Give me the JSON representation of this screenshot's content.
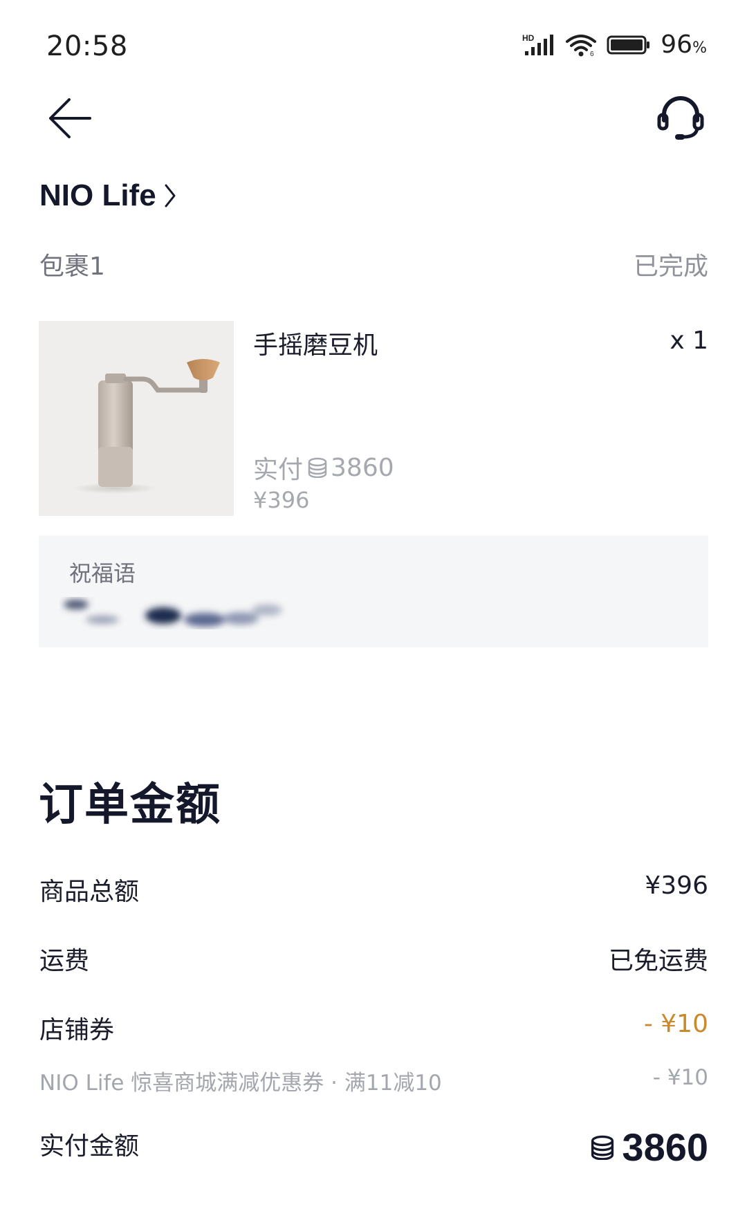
{
  "status_bar": {
    "time": "20:58",
    "battery_percent": "96",
    "battery_unit": "%",
    "signal_badge": "HD"
  },
  "header": {
    "back_icon": "back-arrow-icon",
    "support_icon": "headset-icon"
  },
  "store": {
    "name": "NIO Life",
    "chevron_icon": "chevron-right-icon"
  },
  "package": {
    "label": "包裹1",
    "status": "已完成"
  },
  "product": {
    "name": "手摇磨豆机",
    "quantity": "x 1",
    "paid_prefix": "实付",
    "paid_points": "3860",
    "price": "¥396",
    "image_icon": "coffee-grinder-image"
  },
  "blessing": {
    "label": "祝福语"
  },
  "order_amount": {
    "title": "订单金额",
    "goods_total_label": "商品总额",
    "goods_total_value": "¥396",
    "shipping_label": "运费",
    "shipping_value": "已免运费",
    "coupon_label": "店铺券",
    "coupon_value": "- ¥10",
    "coupon_detail_label": "NIO Life 惊喜商城满减优惠券 · 满11减10",
    "coupon_detail_value": "- ¥10",
    "paid_label": "实付金额",
    "paid_value": "3860"
  },
  "colors": {
    "primary_text": "#1a1c2b",
    "secondary_text": "#a3a6ad",
    "coupon_accent": "#c9892c",
    "panel_bg": "#f5f6f7"
  }
}
